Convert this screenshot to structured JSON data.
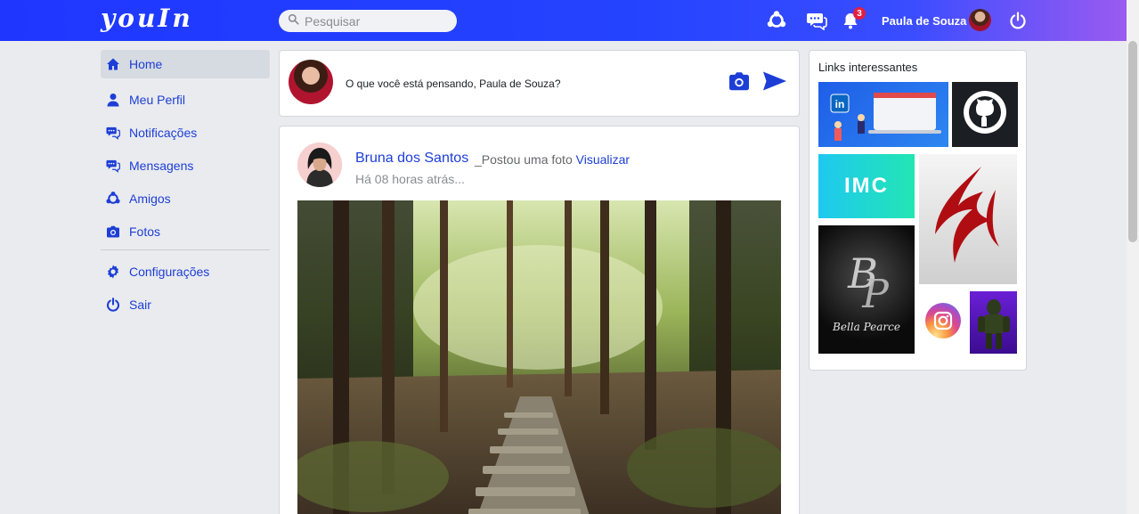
{
  "app": {
    "title": "youIn"
  },
  "search": {
    "placeholder": "Pesquisar"
  },
  "topbar": {
    "notification_count": "3",
    "user_name": "Paula de Souza",
    "icons": [
      "friends-icon",
      "messages-icon",
      "bell-icon",
      "power-icon"
    ]
  },
  "sidebar": {
    "items": [
      {
        "label": "Home",
        "icon": "home-icon",
        "active": true
      },
      {
        "label": "Meu Perfil",
        "icon": "user-icon"
      },
      {
        "label": "Notificações",
        "icon": "chat-icon"
      },
      {
        "label": "Mensagens",
        "icon": "chat-icon"
      },
      {
        "label": "Amigos",
        "icon": "friends-icon"
      },
      {
        "label": "Fotos",
        "icon": "camera-icon"
      }
    ],
    "bottom_items": [
      {
        "label": "Configurações",
        "icon": "gear-icon"
      },
      {
        "label": "Sair",
        "icon": "power-icon"
      }
    ]
  },
  "composer": {
    "prompt": "O que você está pensando, Paula de Souza?",
    "icons": [
      "camera-icon",
      "send-icon"
    ]
  },
  "post": {
    "author": "Bruna dos Santos",
    "action": "_Postou uma foto",
    "view_link": "Visualizar",
    "time": "Há 08 horas atrás..."
  },
  "links_panel": {
    "title": "Links interessantes",
    "tile_imc": "IMC",
    "tile_bella": "Bella Pearce"
  },
  "colors": {
    "accent": "#1d3ed6",
    "topbar_start": "#1f36ff",
    "topbar_end": "#a05bf0",
    "badge": "#e41e3f"
  }
}
